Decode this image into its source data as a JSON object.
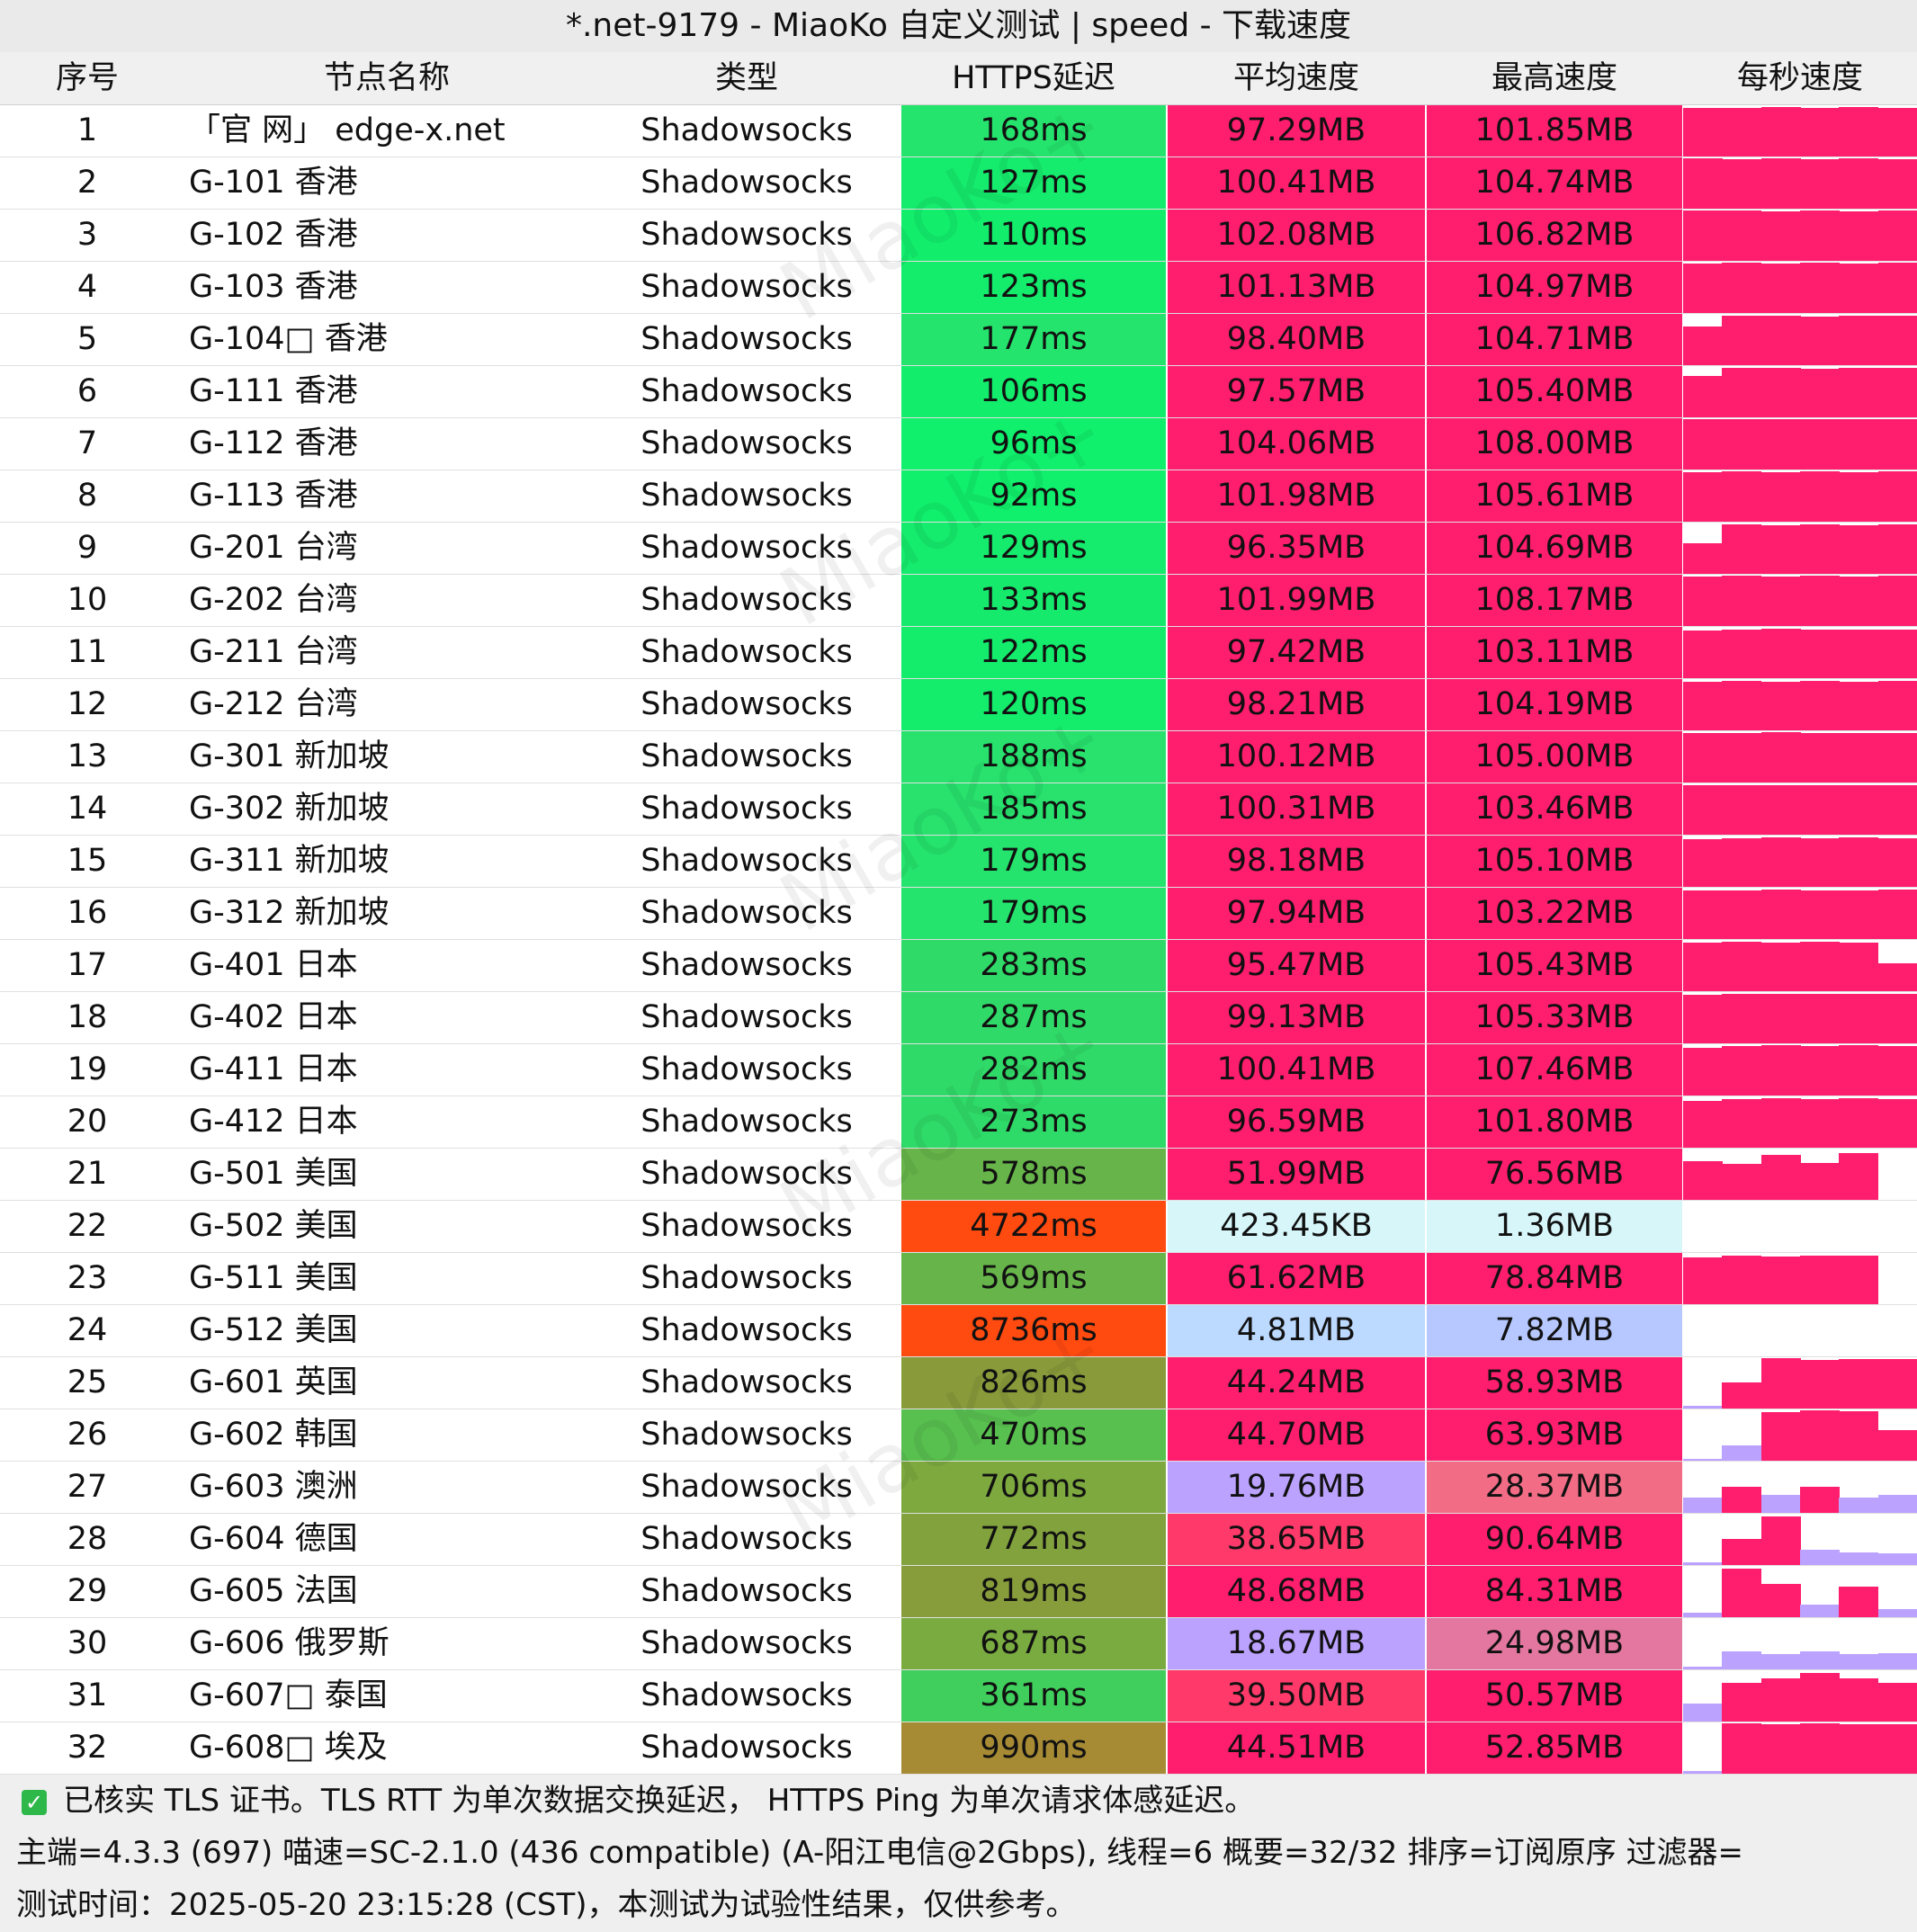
{
  "window_title": "*.net-9179 - MiaoKo 自定义测试 | speed - 下载速度",
  "watermark": "MiaoKo+",
  "columns": [
    "序号",
    "节点名称",
    "类型",
    "HTTPS延迟",
    "平均速度",
    "最高速度",
    "每秒速度"
  ],
  "colors": {
    "speed_high": "#ff1d6e",
    "latency_fast": "#19e86a",
    "latency_slow": "#ff4a10",
    "speed_low_blue": "#bcd9ff",
    "speed_very_low": "#d7f6fa",
    "speed_purple": "#bca2ff"
  },
  "rows": [
    {
      "idx": "1",
      "name": "「官 网」 edge-x.net",
      "type": "Shadowsocks",
      "latency": "168ms",
      "avg": "97.29MB",
      "max": "101.85MB",
      "lat_color": "#25e46d",
      "avg_color": "#ff1d6e",
      "max_color": "#ff1d6e",
      "persec": [
        0.95,
        0.95,
        0.96,
        0.95,
        0.96,
        0.95
      ]
    },
    {
      "idx": "2",
      "name": "G-101 香港",
      "type": "Shadowsocks",
      "latency": "127ms",
      "avg": "100.41MB",
      "max": "104.74MB",
      "lat_color": "#15eb6c",
      "avg_color": "#ff1d6e",
      "max_color": "#ff1d6e",
      "persec": [
        0.98,
        0.97,
        0.98,
        0.96,
        0.99,
        0.97
      ]
    },
    {
      "idx": "3",
      "name": "G-102 香港",
      "type": "Shadowsocks",
      "latency": "110ms",
      "avg": "102.08MB",
      "max": "106.82MB",
      "lat_color": "#12ee6c",
      "avg_color": "#ff1d6e",
      "max_color": "#ff1d6e",
      "persec": [
        0.98,
        0.99,
        0.97,
        0.98,
        0.96,
        0.99
      ]
    },
    {
      "idx": "4",
      "name": "G-103 香港",
      "type": "Shadowsocks",
      "latency": "123ms",
      "avg": "101.13MB",
      "max": "104.97MB",
      "lat_color": "#14ec6c",
      "avg_color": "#ff1d6e",
      "max_color": "#ff1d6e",
      "persec": [
        0.97,
        0.98,
        0.97,
        0.98,
        0.97,
        0.98
      ]
    },
    {
      "idx": "5",
      "name": "G-104□ 香港",
      "type": "Shadowsocks",
      "latency": "177ms",
      "avg": "98.40MB",
      "max": "104.71MB",
      "lat_color": "#25e46d",
      "avg_color": "#ff1d6e",
      "max_color": "#ff1d6e",
      "persec": [
        0.75,
        0.96,
        0.97,
        0.95,
        0.97,
        0.96
      ]
    },
    {
      "idx": "6",
      "name": "G-111 香港",
      "type": "Shadowsocks",
      "latency": "106ms",
      "avg": "97.57MB",
      "max": "105.40MB",
      "lat_color": "#12ee6c",
      "avg_color": "#ff1d6e",
      "max_color": "#ff1d6e",
      "persec": [
        0.8,
        0.96,
        0.97,
        0.95,
        0.96,
        0.97
      ]
    },
    {
      "idx": "7",
      "name": "G-112 香港",
      "type": "Shadowsocks",
      "latency": "96ms",
      "avg": "104.06MB",
      "max": "108.00MB",
      "lat_color": "#10f06c",
      "avg_color": "#ff1d6e",
      "max_color": "#ff1d6e",
      "persec": [
        0.98,
        0.99,
        0.98,
        0.99,
        0.98,
        0.99
      ]
    },
    {
      "idx": "8",
      "name": "G-113 香港",
      "type": "Shadowsocks",
      "latency": "92ms",
      "avg": "101.98MB",
      "max": "105.61MB",
      "lat_color": "#10f06c",
      "avg_color": "#ff1d6e",
      "max_color": "#ff1d6e",
      "persec": [
        0.97,
        0.98,
        0.97,
        0.98,
        0.97,
        0.98
      ]
    },
    {
      "idx": "9",
      "name": "G-201 台湾",
      "type": "Shadowsocks",
      "latency": "129ms",
      "avg": "96.35MB",
      "max": "104.69MB",
      "lat_color": "#15eb6c",
      "avg_color": "#ff1d6e",
      "max_color": "#ff1d6e",
      "persec": [
        0.6,
        0.96,
        0.95,
        0.96,
        0.95,
        0.96
      ]
    },
    {
      "idx": "10",
      "name": "G-202 台湾",
      "type": "Shadowsocks",
      "latency": "133ms",
      "avg": "101.99MB",
      "max": "108.17MB",
      "lat_color": "#16ea6c",
      "avg_color": "#ff1d6e",
      "max_color": "#ff1d6e",
      "persec": [
        0.97,
        0.98,
        0.97,
        0.99,
        0.97,
        0.98
      ]
    },
    {
      "idx": "11",
      "name": "G-211 台湾",
      "type": "Shadowsocks",
      "latency": "122ms",
      "avg": "97.42MB",
      "max": "103.11MB",
      "lat_color": "#14ec6c",
      "avg_color": "#ff1d6e",
      "max_color": "#ff1d6e",
      "persec": [
        0.93,
        0.95,
        0.96,
        0.95,
        0.94,
        0.95
      ]
    },
    {
      "idx": "12",
      "name": "G-212 台湾",
      "type": "Shadowsocks",
      "latency": "120ms",
      "avg": "98.21MB",
      "max": "104.19MB",
      "lat_color": "#14ec6c",
      "avg_color": "#ff1d6e",
      "max_color": "#ff1d6e",
      "persec": [
        0.95,
        0.96,
        0.95,
        0.96,
        0.95,
        0.96
      ]
    },
    {
      "idx": "13",
      "name": "G-301 新加坡",
      "type": "Shadowsocks",
      "latency": "188ms",
      "avg": "100.12MB",
      "max": "105.00MB",
      "lat_color": "#28e26d",
      "avg_color": "#ff1d6e",
      "max_color": "#ff1d6e",
      "persec": [
        0.96,
        0.97,
        0.98,
        0.97,
        0.96,
        0.97
      ]
    },
    {
      "idx": "14",
      "name": "G-302 新加坡",
      "type": "Shadowsocks",
      "latency": "185ms",
      "avg": "100.31MB",
      "max": "103.46MB",
      "lat_color": "#28e26d",
      "avg_color": "#ff1d6e",
      "max_color": "#ff1d6e",
      "persec": [
        0.97,
        0.96,
        0.97,
        0.96,
        0.97,
        0.96
      ]
    },
    {
      "idx": "15",
      "name": "G-311 新加坡",
      "type": "Shadowsocks",
      "latency": "179ms",
      "avg": "98.18MB",
      "max": "105.10MB",
      "lat_color": "#25e46d",
      "avg_color": "#ff1d6e",
      "max_color": "#ff1d6e",
      "persec": [
        0.93,
        0.95,
        0.96,
        0.95,
        0.96,
        0.95
      ]
    },
    {
      "idx": "16",
      "name": "G-312 新加坡",
      "type": "Shadowsocks",
      "latency": "179ms",
      "avg": "97.94MB",
      "max": "103.22MB",
      "lat_color": "#25e46d",
      "avg_color": "#ff1d6e",
      "max_color": "#ff1d6e",
      "persec": [
        0.94,
        0.95,
        0.96,
        0.95,
        0.95,
        0.96
      ]
    },
    {
      "idx": "17",
      "name": "G-401 日本",
      "type": "Shadowsocks",
      "latency": "283ms",
      "avg": "95.47MB",
      "max": "105.43MB",
      "lat_color": "#30da68",
      "avg_color": "#ff1d6e",
      "max_color": "#ff1d6e",
      "persec": [
        0.95,
        0.96,
        0.95,
        0.96,
        0.95,
        0.55
      ]
    },
    {
      "idx": "18",
      "name": "G-402 日本",
      "type": "Shadowsocks",
      "latency": "287ms",
      "avg": "99.13MB",
      "max": "105.33MB",
      "lat_color": "#30da68",
      "avg_color": "#ff1d6e",
      "max_color": "#ff1d6e",
      "persec": [
        0.94,
        0.97,
        0.96,
        0.97,
        0.96,
        0.97
      ]
    },
    {
      "idx": "19",
      "name": "G-411 日本",
      "type": "Shadowsocks",
      "latency": "282ms",
      "avg": "100.41MB",
      "max": "107.46MB",
      "lat_color": "#30da68",
      "avg_color": "#ff1d6e",
      "max_color": "#ff1d6e",
      "persec": [
        0.93,
        0.97,
        0.98,
        0.97,
        0.98,
        0.97
      ]
    },
    {
      "idx": "20",
      "name": "G-412 日本",
      "type": "Shadowsocks",
      "latency": "273ms",
      "avg": "96.59MB",
      "max": "101.80MB",
      "lat_color": "#2fdb68",
      "avg_color": "#ff1d6e",
      "max_color": "#ff1d6e",
      "persec": [
        0.92,
        0.95,
        0.96,
        0.95,
        0.96,
        0.95
      ]
    },
    {
      "idx": "21",
      "name": "G-501 美国",
      "type": "Shadowsocks",
      "latency": "578ms",
      "avg": "51.99MB",
      "max": "76.56MB",
      "lat_color": "#67b54a",
      "avg_color": "#ff1d6e",
      "max_color": "#ff1d6e",
      "persec": [
        0.75,
        0.7,
        0.88,
        0.72,
        0.92,
        0.0
      ]
    },
    {
      "idx": "22",
      "name": "G-502 美国",
      "type": "Shadowsocks",
      "latency": "4722ms",
      "avg": "423.45KB",
      "max": "1.36MB",
      "lat_color": "#ff4a10",
      "avg_color": "#d7f6fa",
      "max_color": "#d7f6fa",
      "persec": [
        0.0,
        0.0,
        0.0,
        0.0,
        0.0,
        0.0
      ]
    },
    {
      "idx": "23",
      "name": "G-511 美国",
      "type": "Shadowsocks",
      "latency": "569ms",
      "avg": "61.62MB",
      "max": "78.84MB",
      "lat_color": "#67b54a",
      "avg_color": "#ff1d6e",
      "max_color": "#ff1d6e",
      "persec": [
        0.92,
        0.95,
        0.93,
        0.94,
        0.95,
        0.0
      ]
    },
    {
      "idx": "24",
      "name": "G-512 美国",
      "type": "Shadowsocks",
      "latency": "8736ms",
      "avg": "4.81MB",
      "max": "7.82MB",
      "lat_color": "#ff4a10",
      "avg_color": "#bcd9ff",
      "max_color": "#b6c8ff",
      "persec": [
        0.0,
        0.0,
        0.0,
        0.0,
        0.0,
        0.0
      ]
    },
    {
      "idx": "25",
      "name": "G-601 英国",
      "type": "Shadowsocks",
      "latency": "826ms",
      "avg": "44.24MB",
      "max": "58.93MB",
      "lat_color": "#889a3a",
      "avg_color": "#ff1d6e",
      "max_color": "#ff1d6e",
      "persec": [
        0.05,
        0.5,
        0.98,
        0.95,
        0.96,
        0.96
      ]
    },
    {
      "idx": "26",
      "name": "G-602 韩国",
      "type": "Shadowsocks",
      "latency": "470ms",
      "avg": "44.70MB",
      "max": "63.93MB",
      "lat_color": "#58c04f",
      "avg_color": "#ff1d6e",
      "max_color": "#ff1d6e",
      "persec": [
        0.03,
        0.3,
        0.95,
        0.98,
        0.96,
        0.6
      ]
    },
    {
      "idx": "27",
      "name": "G-603 澳洲",
      "type": "Shadowsocks",
      "latency": "706ms",
      "avg": "19.76MB",
      "max": "28.37MB",
      "lat_color": "#7da93f",
      "avg_color": "#bca2ff",
      "max_color": "#f26c86",
      "persec": [
        0.3,
        0.5,
        0.35,
        0.5,
        0.3,
        0.35
      ]
    },
    {
      "idx": "28",
      "name": "G-604 德国",
      "type": "Shadowsocks",
      "latency": "772ms",
      "avg": "38.65MB",
      "max": "90.64MB",
      "lat_color": "#82a23d",
      "avg_color": "#ff3a6a",
      "max_color": "#ff1d6e",
      "persec": [
        0.05,
        0.5,
        0.95,
        0.3,
        0.25,
        0.22
      ]
    },
    {
      "idx": "29",
      "name": "G-605 法国",
      "type": "Shadowsocks",
      "latency": "819ms",
      "avg": "48.68MB",
      "max": "84.31MB",
      "lat_color": "#879c3b",
      "avg_color": "#ff1d6e",
      "max_color": "#ff1d6e",
      "persec": [
        0.08,
        0.95,
        0.65,
        0.25,
        0.6,
        0.15
      ]
    },
    {
      "idx": "30",
      "name": "G-606 俄罗斯",
      "type": "Shadowsocks",
      "latency": "687ms",
      "avg": "18.67MB",
      "max": "24.98MB",
      "lat_color": "#7aab40",
      "avg_color": "#bca2ff",
      "max_color": "#e3779f",
      "persec": [
        0.05,
        0.35,
        0.3,
        0.35,
        0.3,
        0.32
      ]
    },
    {
      "idx": "31",
      "name": "G-607□ 泰国",
      "type": "Shadowsocks",
      "latency": "361ms",
      "avg": "39.50MB",
      "max": "50.57MB",
      "lat_color": "#40ce5c",
      "avg_color": "#ff3a6a",
      "max_color": "#ff1d6e",
      "persec": [
        0.35,
        0.75,
        0.85,
        0.95,
        0.85,
        0.75
      ]
    },
    {
      "idx": "32",
      "name": "G-608□ 埃及",
      "type": "Shadowsocks",
      "latency": "990ms",
      "avg": "44.51MB",
      "max": "52.85MB",
      "lat_color": "#a68a34",
      "avg_color": "#ff1d6e",
      "max_color": "#ff1d6e",
      "persec": [
        0.05,
        0.98,
        0.97,
        0.98,
        0.97,
        0.96
      ]
    }
  ],
  "footer": {
    "line1": "已核实 TLS 证书。TLS RTT 为单次数据交换延迟， HTTPS Ping 为单次请求体感延迟。",
    "line2": "主端=4.3.3 (697) 喵速=SC-2.1.0 (436 compatible) (A-阳江电信@2Gbps), 线程=6 概要=32/32 排序=订阅原序 过滤器=",
    "line3": "测试时间：2025-05-20 23:15:28 (CST)，本测试为试验性结果，仅供参考。"
  }
}
